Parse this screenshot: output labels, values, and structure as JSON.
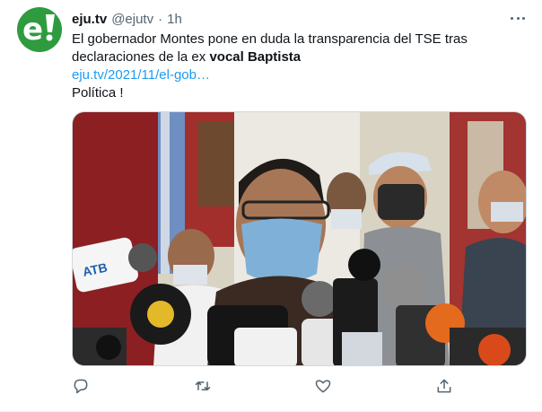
{
  "tweet": {
    "author_name": "eju.tv",
    "author_handle": "@ejutv",
    "separator": "·",
    "time": "1h",
    "text_line1": "El gobernador Montes pone en duda la transparencia del TSE tras",
    "text_line2_plain": "declaraciones de la ex ",
    "text_line2_bold": "vocal Baptista",
    "link": "eju.tv/2021/11/el-gob…",
    "category_line": "Política !",
    "avatar_letter": "e",
    "avatar_color": "#2e9b3f",
    "link_color": "#1d9bf0"
  },
  "media": {
    "description_icon": "press-conference-photo",
    "mic_brand": "ATB"
  },
  "actions": {
    "reply_icon": "reply-icon",
    "retweet_icon": "retweet-icon",
    "like_icon": "heart-icon",
    "share_icon": "share-icon"
  }
}
